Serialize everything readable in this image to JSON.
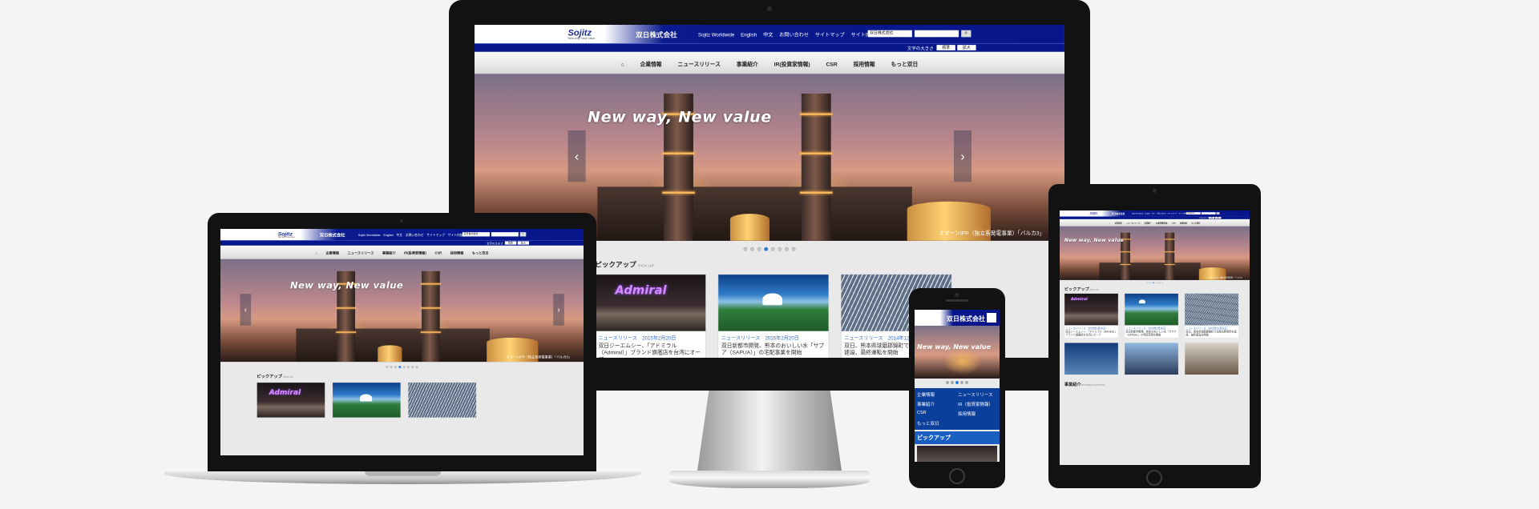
{
  "site": {
    "logo": {
      "mark": "Sojitz",
      "tagline": "New way, New value"
    },
    "corp_name": "双日株式会社",
    "utility_links": [
      "Sojitz Worldwide",
      "English",
      "中文",
      "お問い合わせ",
      "サイトマップ",
      "サイト内検索"
    ],
    "site_select": "双日株式会社",
    "font_size_label": "文字の大きさ",
    "font_size_buttons": [
      "標準",
      "拡大"
    ],
    "nav": [
      "企業情報",
      "ニュースリリース",
      "事業紹介",
      "IR(投資家情報)",
      "CSR",
      "採用情報",
      "もっと双日"
    ],
    "hero": {
      "tagline": "New way, New value",
      "caption": "オマーンIPP（独立系発電事業）「バルカ3」",
      "slide_count": 8,
      "active_slide": 4
    },
    "pickup": {
      "title": "ピックアップ",
      "subtitle": "PICK UP",
      "cards": [
        {
          "image": "admiral-store",
          "image_text": "Admiral",
          "meta": "ニュースリリース　2015年2月20日",
          "text": "双日ジーエムシー、「アドミラル（Admiral）」ブランド旗艦店を台湾にオープ"
        },
        {
          "image": "mountain-sky",
          "meta": "ニュースリリース　2015年2月20日",
          "text": "双日新都市開発、熊本のおいしい水「サプア（SAPUA）」の宅配事業を開始"
        },
        {
          "image": "solar-farm",
          "meta": "ニュースリリース　2014年12月11日",
          "text": "双日、熊本県球磨郡錦町で太陽光発電所を建設、最終運転を開始"
        }
      ]
    }
  },
  "mobile": {
    "header": "双日株式会社",
    "hero_text": "New way, New value",
    "nav": [
      "企業情報",
      "ニュースリリース",
      "事業紹介",
      "IR（投資家情報）",
      "CSR",
      "採用情報",
      "もっと双日"
    ],
    "pickup": "ピックアップ"
  },
  "tablet": {
    "section": "事業紹介",
    "section_sub": "BUSINESS ACTIVITIES"
  }
}
